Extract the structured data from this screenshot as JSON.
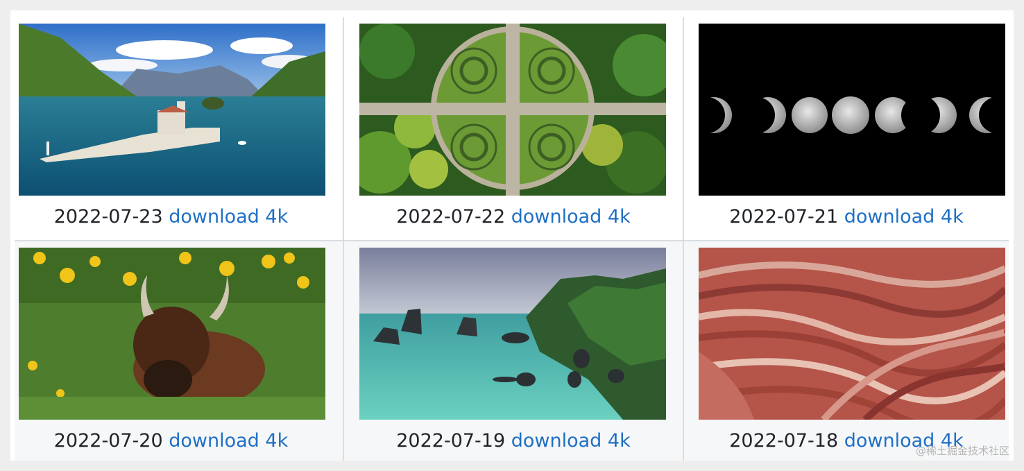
{
  "gallery": {
    "items": [
      {
        "date": "2022-07-23",
        "link": "download 4k"
      },
      {
        "date": "2022-07-22",
        "link": "download 4k"
      },
      {
        "date": "2022-07-21",
        "link": "download 4k"
      },
      {
        "date": "2022-07-20",
        "link": "download 4k"
      },
      {
        "date": "2022-07-19",
        "link": "download 4k"
      },
      {
        "date": "2022-07-18",
        "link": "download 4k"
      }
    ]
  },
  "watermark": "@稀土掘金技术社区",
  "colors": {
    "link": "#1e6fc5",
    "text": "#212529",
    "divider": "#d8dde2"
  }
}
